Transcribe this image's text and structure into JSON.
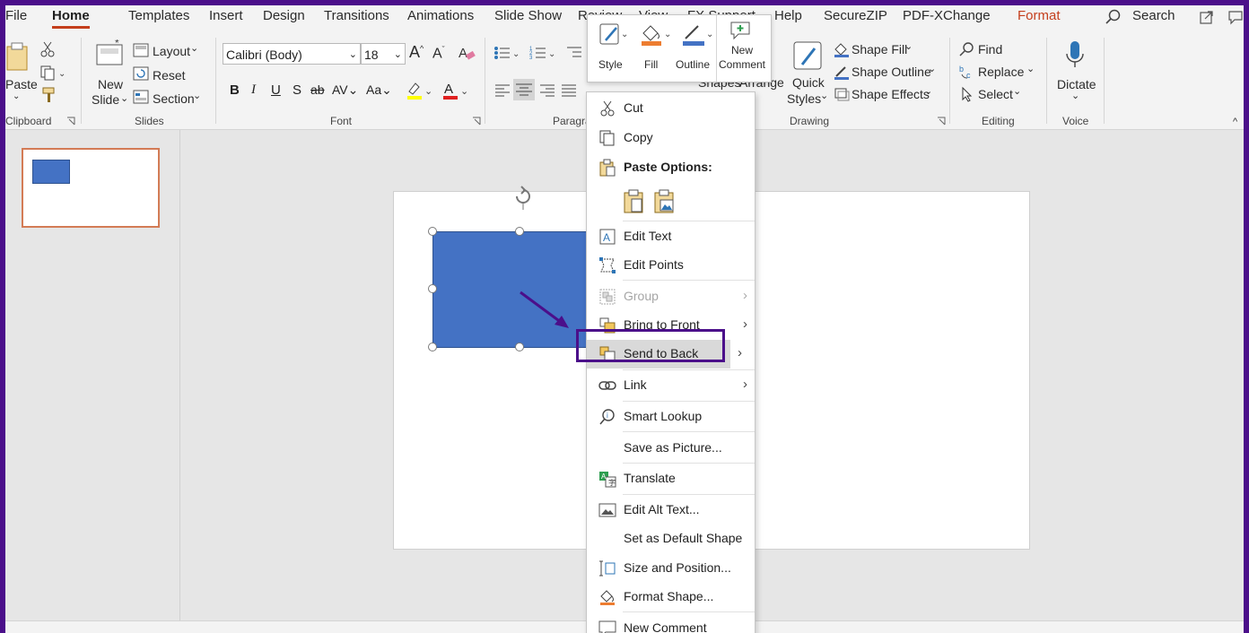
{
  "tabs": [
    "File",
    "Home",
    "Templates",
    "Insert",
    "Design",
    "Transitions",
    "Animations",
    "Slide Show",
    "Review",
    "View",
    "FX Support",
    "Help",
    "SecureZIP",
    "PDF-XChange",
    "Format"
  ],
  "search": {
    "label": "Search"
  },
  "ribbon": {
    "clipboard": {
      "paste": "Paste",
      "group": "Clipboard"
    },
    "slides": {
      "new_slide_1": "New",
      "new_slide_2": "Slide",
      "layout": "Layout",
      "reset": "Reset",
      "section": "Section",
      "group": "Slides"
    },
    "font": {
      "name": "Calibri (Body)",
      "size": "18",
      "group": "Font"
    },
    "paragraph": {
      "group": "Paragra"
    },
    "drawing": {
      "shapes": "Shapes",
      "arrange": "Arrange",
      "quick_1": "Quick",
      "quick_2": "Styles",
      "shape_fill": "Shape Fill",
      "shape_outline": "Shape Outline",
      "shape_effects": "Shape Effects",
      "group": "Drawing"
    },
    "editing": {
      "find": "Find",
      "replace": "Replace",
      "select": "Select",
      "group": "Editing"
    },
    "voice": {
      "dictate": "Dictate",
      "group": "Voice"
    }
  },
  "mini_toolbar": {
    "style": "Style",
    "fill": "Fill",
    "outline": "Outline",
    "new_comment_1": "New",
    "new_comment_2": "Comment"
  },
  "context_menu": {
    "cut": "Cut",
    "copy": "Copy",
    "paste_options": "Paste Options:",
    "edit_text": "Edit Text",
    "edit_points": "Edit Points",
    "group": "Group",
    "bring_to_front": "Bring to Front",
    "send_to_back": "Send to Back",
    "link": "Link",
    "smart_lookup": "Smart Lookup",
    "save_as_picture": "Save as Picture...",
    "translate": "Translate",
    "edit_alt_text": "Edit Alt Text...",
    "set_default_shape": "Set as Default Shape",
    "size_and_position": "Size and Position...",
    "format_shape": "Format Shape...",
    "new_comment": "New Comment"
  },
  "colors": {
    "accent": "#c43e1c",
    "shape_fill": "#4472c4",
    "highlight_frame": "#4b0f8a"
  }
}
